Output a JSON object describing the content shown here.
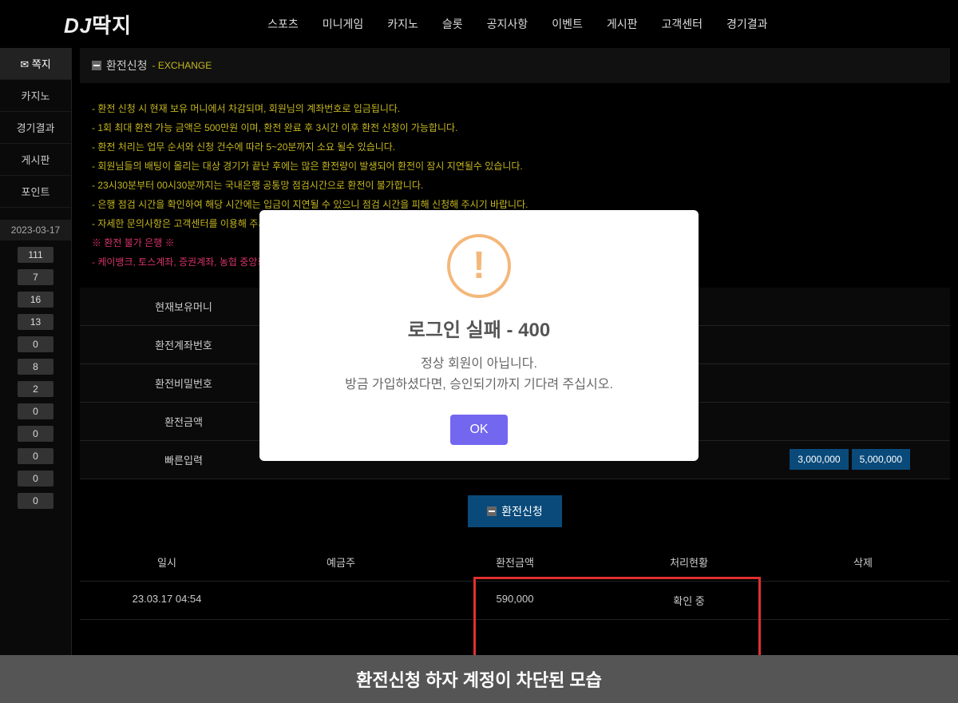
{
  "logo": "DJ딱지",
  "nav": [
    "스포츠",
    "미니게임",
    "카지노",
    "슬롯",
    "공지사항",
    "이벤트",
    "게시판",
    "고객센터",
    "경기결과"
  ],
  "sidebar": {
    "items": [
      "쪽지",
      "카지노",
      "경기결과",
      "게시판",
      "포인트"
    ],
    "date": "2023-03-17",
    "badges": [
      "111",
      "7",
      "16",
      "13",
      "0",
      "8",
      "2",
      "0",
      "0",
      "0",
      "0",
      "0"
    ]
  },
  "page": {
    "title": "환전신청",
    "subtitle": "- EXCHANGE"
  },
  "notices": [
    "- 환전 신청 시 현재 보유 머니에서 차감되며, 회원님의 계좌번호로 입금됩니다.",
    "- 1회 최대 환전 가능 금액은 500만원 이며, 환전 완료 후 3시간 이후 환전 신청이 가능합니다.",
    "- 환전 처리는 업무 순서와 신청 건수에 따라 5~20분까지 소요 될수 있습니다.",
    "- 회원님들의 배팅이 몰리는 대상 경기가 끝난 후에는 많은 환전량이 발생되어 환전이 잠시 지연될수 있습니다.",
    "- 23시30분부터 00시30분까지는 국내은행 공통망 점검시간으로 환전이 불가합니다.",
    "- 은행 점검 시간을 확인하여 해당 시간에는 입금이 지연될 수 있으니 점검 시간을 피해 신청해 주시기 바랍니다.",
    "- 자세한 문의사항은 고객센터를 이용해 주시기"
  ],
  "warn": {
    "title": "※ 환전 불가 은행 ※",
    "banks": "- 케이뱅크, 토스계좌, 증권계좌, 농협 중앙회, 지"
  },
  "form": {
    "labels": [
      "현재보유머니",
      "환전계좌번호",
      "환전비밀번호",
      "환전금액",
      "빠른입력"
    ],
    "quick": [
      "3,000,000",
      "5,000,000"
    ],
    "submit": "환전신청"
  },
  "table": {
    "headers": [
      "일시",
      "예금주",
      "환전금액",
      "처리현황",
      "삭제"
    ],
    "rows": [
      {
        "date": "23.03.17 04:54",
        "holder": "",
        "amount": "590,000",
        "status": "확인 중",
        "del": ""
      }
    ]
  },
  "modal": {
    "title": "로그인 실패 - 400",
    "line1": "정상 회원이 아닙니다.",
    "line2": "방금 가입하셨다면, 승인되기까지 기다려 주십시오.",
    "ok": "OK"
  },
  "caption": "환전신청 하자 계정이 차단된 모습"
}
